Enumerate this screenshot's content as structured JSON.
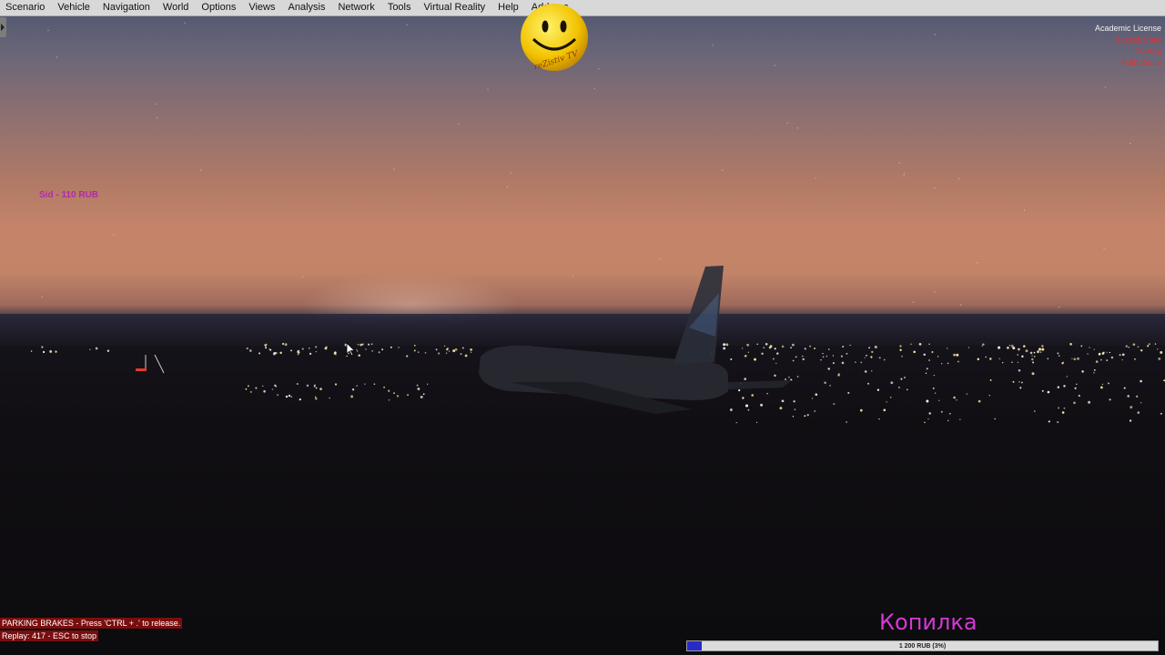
{
  "menubar": {
    "items": [
      "Scenario",
      "Vehicle",
      "Navigation",
      "World",
      "Options",
      "Views",
      "Analysis",
      "Network",
      "Tools",
      "Virtual Reality",
      "Help",
      "Add-ons"
    ]
  },
  "overlay": {
    "license": "Academic License",
    "view_name": "Aircraft View",
    "camera_mode": "Trailing",
    "zoom": "0.80 Zoom"
  },
  "stream": {
    "logo_text": "reZistiv TV",
    "donor_note": "Sid - 110 RUB",
    "goal_label": "Копилка",
    "goal_text": "1 200 RUB (3%)",
    "goal_progress": 0.03
  },
  "status": {
    "parking_brakes": "PARKING BRAKES - Press 'CTRL + .' to release.",
    "replay": "Replay: 417 - ESC to stop"
  },
  "colors": {
    "menu_bg": "#d8d8d8",
    "status_bg": "#7a0d0d",
    "accent_magenta": "#d43ad4",
    "progress_fill": "#2a2ac8"
  }
}
